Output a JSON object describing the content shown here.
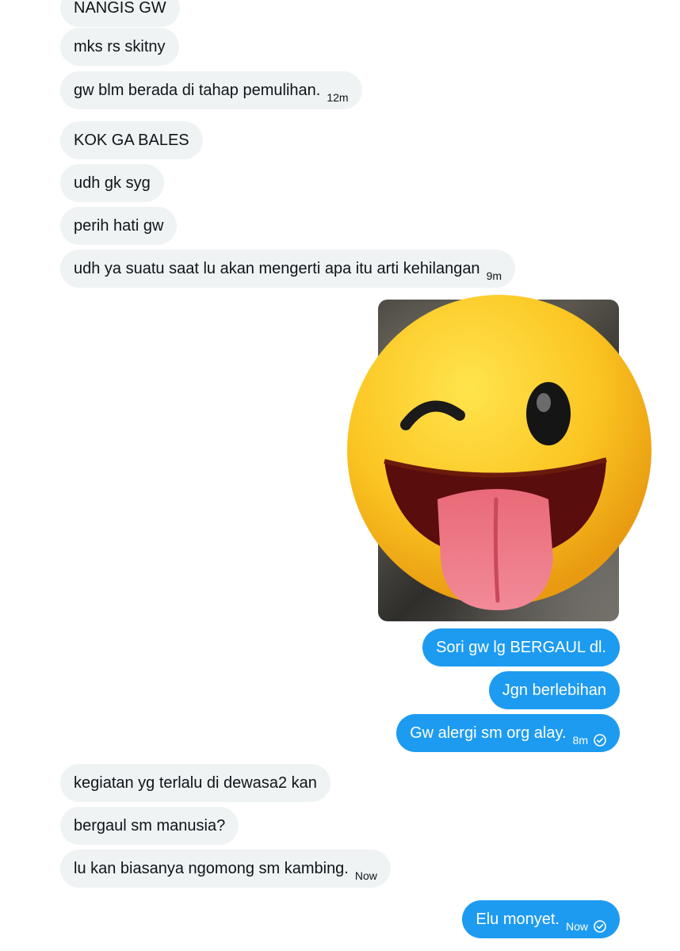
{
  "messages": [
    {
      "dir": "in",
      "text": "NANGIS GW",
      "time": ""
    },
    {
      "dir": "in",
      "text": "mks rs skitny",
      "time": ""
    },
    {
      "dir": "in",
      "text": "gw blm berada di tahap pemulihan.",
      "time": "12m"
    },
    {
      "dir": "in",
      "text": "KOK GA BALES",
      "time": ""
    },
    {
      "dir": "in",
      "text": "udh gk syg",
      "time": ""
    },
    {
      "dir": "in",
      "text": "perih hati gw",
      "time": ""
    },
    {
      "dir": "in",
      "text": "udh ya suatu saat lu akan mengerti apa itu arti kehilangan",
      "time": "9m"
    },
    {
      "dir": "out",
      "text": "Sori gw lg BERGAUL dl.",
      "time": ""
    },
    {
      "dir": "out",
      "text": "Jgn berlebihan",
      "time": ""
    },
    {
      "dir": "out",
      "text": "Gw alergi sm org alay.",
      "time": "8m",
      "status": "read-check-icon"
    },
    {
      "dir": "in",
      "text": "kegiatan yg terlalu di dewasa2 kan",
      "time": ""
    },
    {
      "dir": "in",
      "text": "bergaul sm manusia?",
      "time": ""
    },
    {
      "dir": "in",
      "text": "lu kan biasanya ngomong sm kambing.",
      "time": "Now"
    },
    {
      "dir": "out",
      "text": "Elu monyet.",
      "time": "Now",
      "status": "read-check-icon"
    }
  ],
  "media": {
    "emoji": "winking-face-with-tongue",
    "type": "sent-image"
  },
  "colors": {
    "incoming_bg": "#eff3f4",
    "outgoing_bg": "#1d9bf0",
    "text_dark": "#0f1419"
  }
}
